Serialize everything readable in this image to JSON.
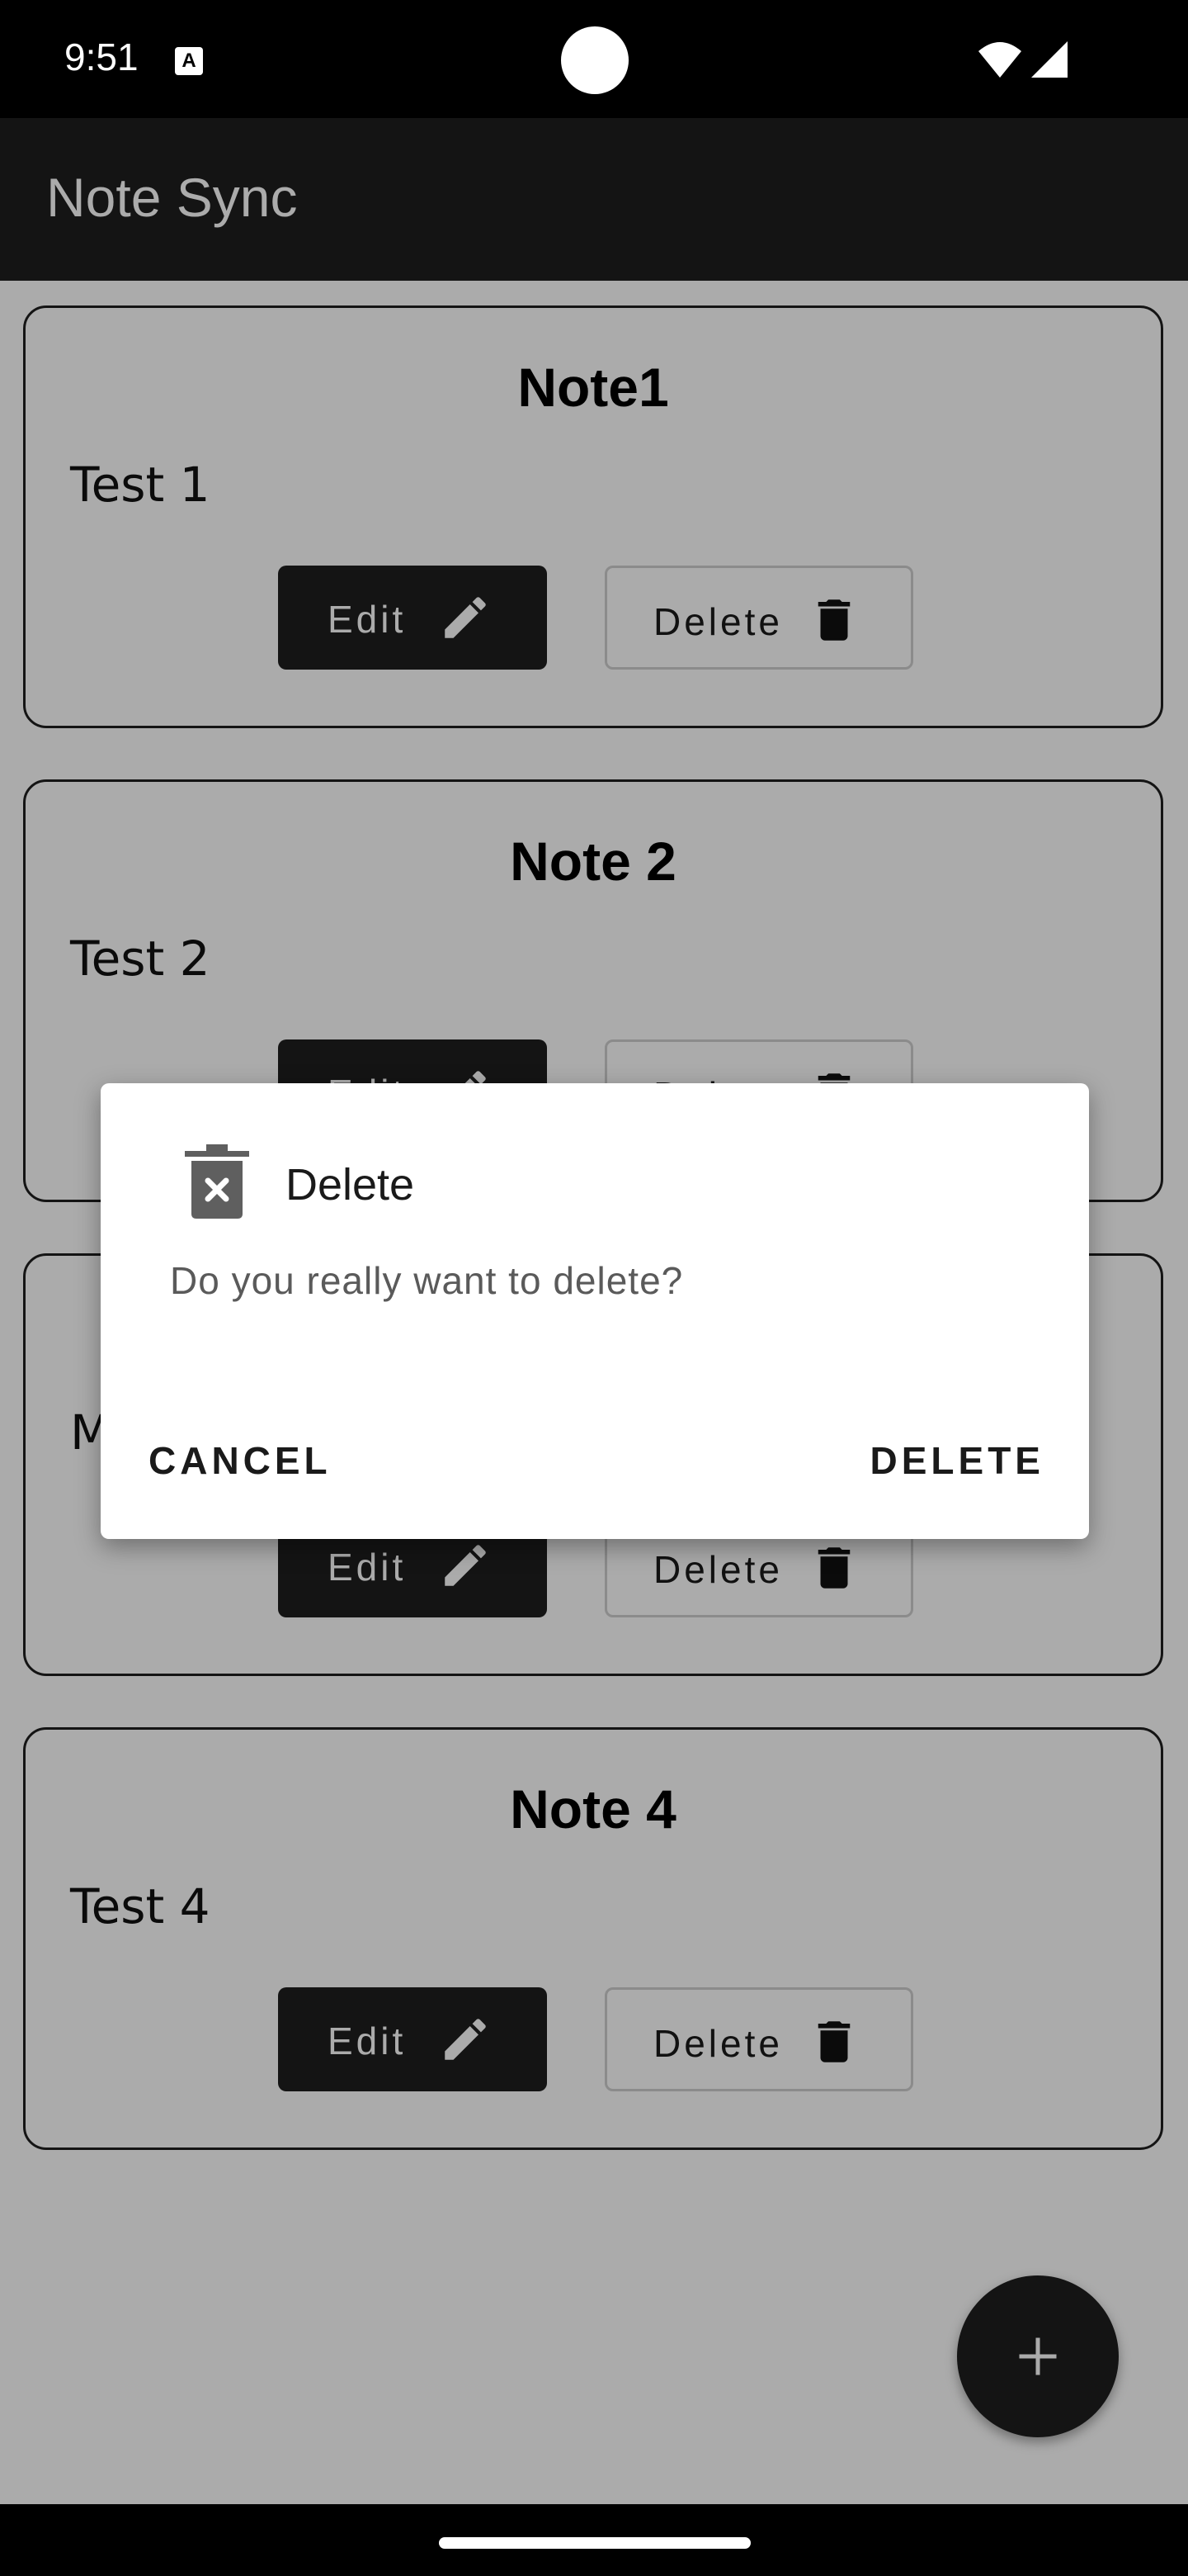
{
  "status_bar": {
    "time": "9:51",
    "a_icon_letter": "A"
  },
  "app_bar": {
    "title": "Note Sync"
  },
  "notes": [
    {
      "title": "Note1",
      "body": "Test 1",
      "edit_label": "Edit",
      "delete_label": "Delete"
    },
    {
      "title": "Note 2",
      "body": "Test 2",
      "edit_label": "Edit",
      "delete_label": "Delete"
    },
    {
      "title": "",
      "body": "M",
      "edit_label": "Edit",
      "delete_label": "Delete"
    },
    {
      "title": "Note 4",
      "body": "Test 4",
      "edit_label": "Edit",
      "delete_label": "Delete"
    }
  ],
  "fab": {
    "icon": "plus-icon"
  },
  "dialog": {
    "title": "Delete",
    "message": "Do you really want to delete?",
    "cancel_label": "CANCEL",
    "confirm_label": "DELETE",
    "icon": "trash-x-icon"
  },
  "colors": {
    "app_bar": "#1f1f1f",
    "edit_button": "#1f1f1f",
    "scrim": "rgba(0,0,0,0.33)",
    "dialog_bg": "#ffffff"
  }
}
